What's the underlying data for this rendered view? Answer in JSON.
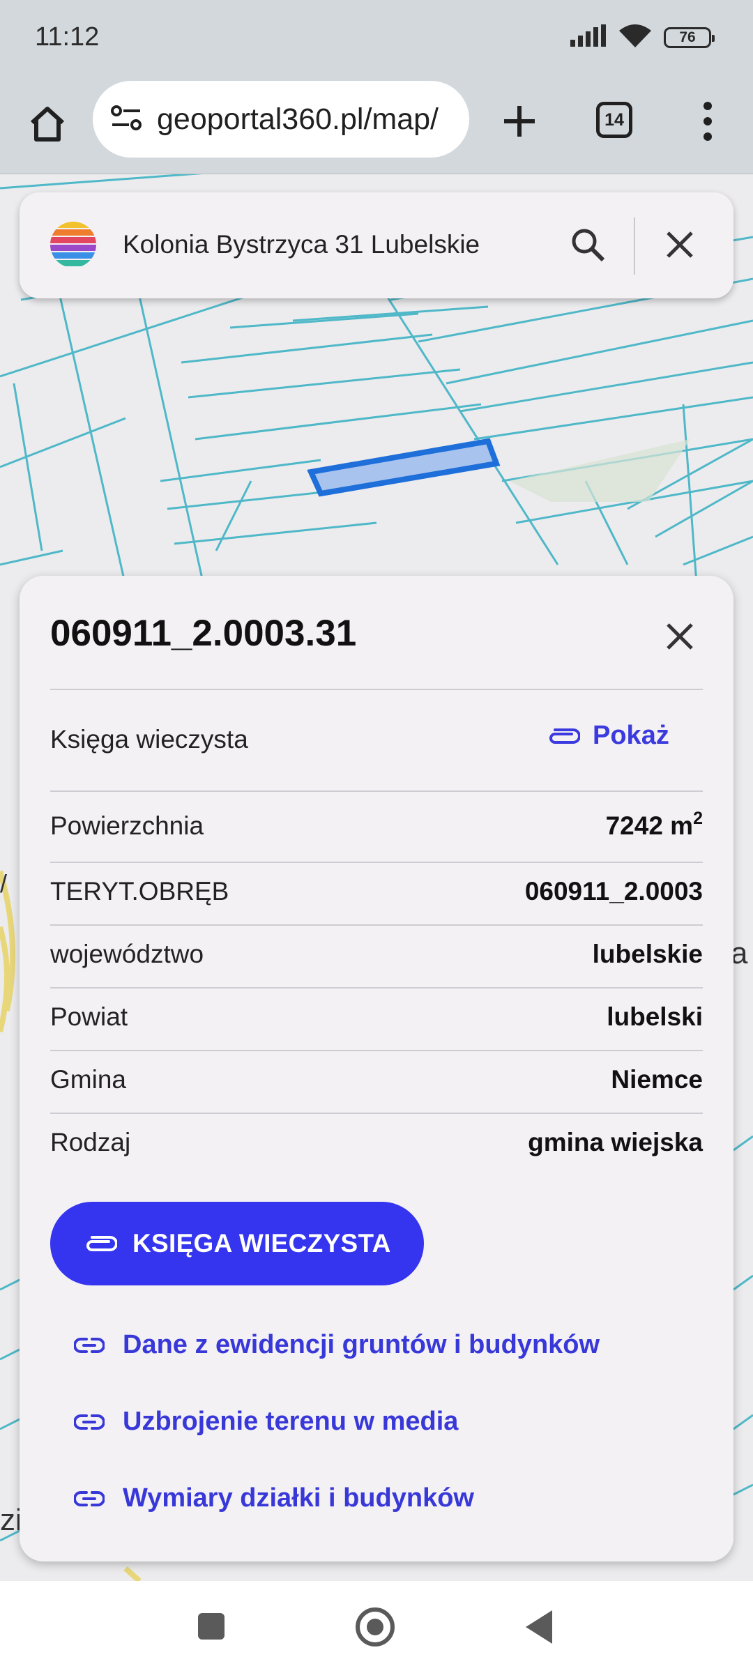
{
  "status_bar": {
    "time": "11:12",
    "battery": "76",
    "icons": [
      "signal-icon",
      "wifi-icon",
      "battery-icon"
    ]
  },
  "browser": {
    "url": "geoportal360.pl/map/",
    "tab_count": "14",
    "icons": [
      "home-icon",
      "site-info-icon",
      "plus-icon",
      "tabs-icon",
      "more-vert-icon"
    ]
  },
  "search": {
    "query": "Kolonia Bystrzyca 31 Lubelskie",
    "icons": [
      "app-logo",
      "search-icon",
      "close-icon"
    ]
  },
  "parcel": {
    "title": "060911_2.0003.31",
    "land_register": {
      "label": "Księga wieczysta",
      "action_label": "Pokaż"
    },
    "rows": [
      {
        "label": "Powierzchnia",
        "value": "7242 m",
        "sup": "2"
      },
      {
        "label": "TERYT.OBRĘB",
        "value": "060911_2.0003"
      },
      {
        "label": "województwo",
        "value": "lubelskie"
      },
      {
        "label": "Powiat",
        "value": "lubelski"
      },
      {
        "label": "Gmina",
        "value": "Niemce"
      },
      {
        "label": "Rodzaj",
        "value": "gmina wiejska"
      }
    ],
    "primary_button": "KSIĘGA WIECZYSTA",
    "links": [
      "Dane z ewidencji gruntów i budynków",
      "Uzbrojenie terenu w media",
      "Wymiary działki i budynków"
    ]
  },
  "map_labels": [
    "a",
    "zi",
    "/"
  ],
  "colors": {
    "accent": "#3535F0",
    "link": "#3838D8",
    "parcel_lines": "#4FB8C8",
    "selected_parcel": "#1E6FD9",
    "panel_bg": "#F4F1F5"
  }
}
